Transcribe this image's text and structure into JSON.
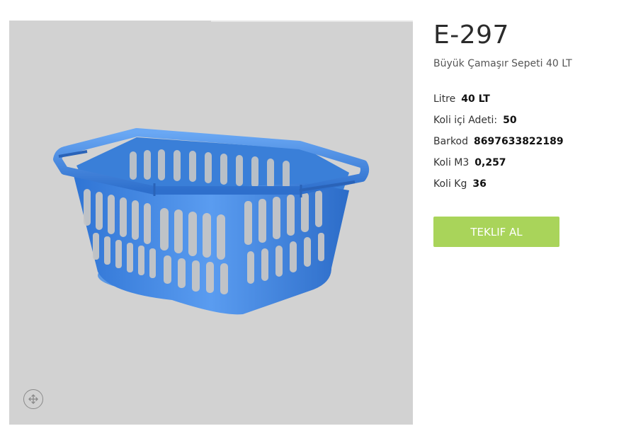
{
  "product": {
    "code": "E-297",
    "name": "Büyük Çamaşır Sepeti 40 LT",
    "image_alt": "Büyük Çamaşır Sepeti 40 LT"
  },
  "specs": [
    {
      "label": "Litre",
      "value": "40 LT"
    },
    {
      "label": "Koli içi Adeti:",
      "value": "50"
    },
    {
      "label": "Barkod",
      "value": "8697633822189"
    },
    {
      "label": "Koli M3",
      "value": "0,257"
    },
    {
      "label": "Koli Kg",
      "value": "36"
    }
  ],
  "cta": {
    "label": "TEKLIF AL",
    "color": "#a9d45a"
  },
  "gallery": {
    "zoom_icon": "move-arrows-icon",
    "background": "#d2d2d2",
    "basket_color": "#3f86e0"
  }
}
